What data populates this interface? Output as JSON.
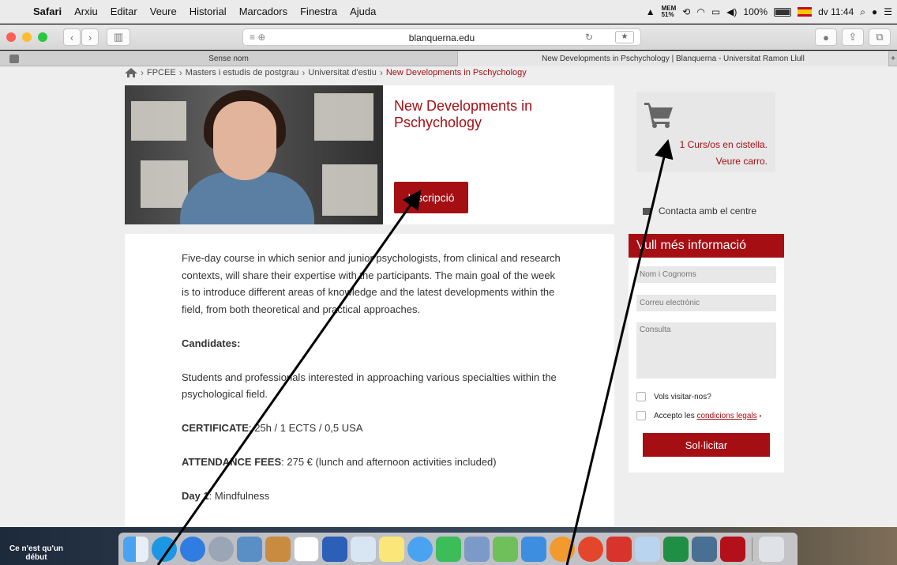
{
  "menubar": {
    "app": "Safari",
    "items": [
      "Arxiu",
      "Editar",
      "Veure",
      "Historial",
      "Marcadors",
      "Finestra",
      "Ajuda"
    ],
    "mem_label": "MEM",
    "mem_value": "51%",
    "battery": "100%",
    "clock": "dv 11:44"
  },
  "toolbar": {
    "url": "blanquerna.edu"
  },
  "tabs": [
    {
      "label": "Sense nom"
    },
    {
      "label": "New Developments in Pschychology | Blanquerna - Universitat Ramon Llull"
    }
  ],
  "breadcrumb": {
    "items": [
      "FPCEE",
      "Masters i estudis de postgrau",
      "Universitat d'estiu"
    ],
    "current": "New Developments in Pschychology"
  },
  "hero": {
    "title": "New Developments in Pschychology",
    "button": "Inscripció"
  },
  "cart": {
    "count_text": "1 Curs/os en cistella.",
    "link": "Veure carro."
  },
  "contact": "Contacta amb el centre",
  "content": {
    "intro": "Five-day course in which senior and junior psychologists, from clinical and research contexts, will share their expertise with the participants. The main goal of the week is to introduce different areas of knowledge and the latest developments within the field, from both theoretical and practical approaches.",
    "candidates_heading": "Candidates:",
    "candidates_text": "Students and professionals interested in approaching various specialties within the psychological field.",
    "certificate_label": "CERTIFICATE",
    "certificate_text": ": 25h / 1 ECTS / 0,5 USA",
    "fees_label": "ATTENDANCE FEES",
    "fees_text": ": 275 € (lunch and afternoon activities included)",
    "day1_label": "Day 1",
    "day1_text": ": Mindfulness"
  },
  "form": {
    "header": "Vull més informació",
    "name_placeholder": "Nom i Cognoms",
    "email_placeholder": "Correu electrònic",
    "query_placeholder": "Consulta",
    "visit_label": "Vols visitar-nos?",
    "accept_label": "Accepto les",
    "accept_link": "condicions legals",
    "required_mark": "•",
    "submit": "Sol·licitar"
  },
  "desktop": {
    "note": "Ce n'est qu'un début"
  },
  "colors": {
    "brand_red": "#a50f14"
  },
  "icons": [
    "apple-icon",
    "home-icon",
    "cart-icon",
    "mail-icon",
    "arrow-annotation"
  ]
}
